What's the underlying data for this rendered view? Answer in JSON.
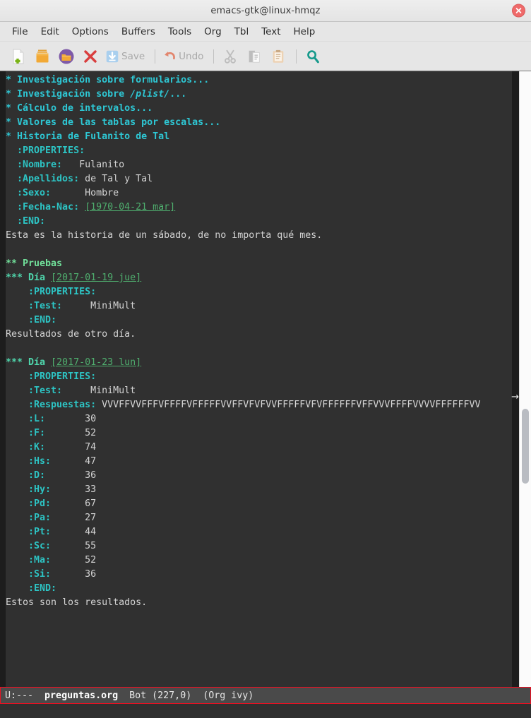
{
  "window": {
    "title": "emacs-gtk@linux-hmqz",
    "close_icon": "close-icon"
  },
  "menubar": {
    "items": [
      {
        "label": "File",
        "name": "menu-file"
      },
      {
        "label": "Edit",
        "name": "menu-edit"
      },
      {
        "label": "Options",
        "name": "menu-options"
      },
      {
        "label": "Buffers",
        "name": "menu-buffers"
      },
      {
        "label": "Tools",
        "name": "menu-tools"
      },
      {
        "label": "Org",
        "name": "menu-org"
      },
      {
        "label": "Tbl",
        "name": "menu-tbl"
      },
      {
        "label": "Text",
        "name": "menu-text"
      },
      {
        "label": "Help",
        "name": "menu-help"
      }
    ]
  },
  "toolbar": {
    "new_file_icon": "new-file-icon",
    "open_file_icon": "open-folder-icon",
    "dired_icon": "open-directory-icon",
    "close_buffer_icon": "close-buffer-icon",
    "save_icon": "save-icon",
    "save_label": "Save",
    "undo_icon": "undo-icon",
    "undo_label": "Undo",
    "cut_icon": "cut-icon",
    "copy_icon": "copy-icon",
    "paste_icon": "paste-icon",
    "search_icon": "search-icon"
  },
  "buffer": {
    "headings": {
      "h1_1": "* Investigación sobre formularios...",
      "h1_2_pre": "* Investigación sobre ",
      "h1_2_ital": "/plist/",
      "h1_2_post": "...",
      "h1_3": "* Cálculo de intervalos...",
      "h1_4": "* Valores de las tablas por escalas...",
      "h1_5": "* Historia de Fulanito de Tal"
    },
    "person_props": {
      "begin": "  :PROPERTIES:",
      "rows": [
        {
          "key": "  :Nombre:   ",
          "value": "Fulanito"
        },
        {
          "key": "  :Apellidos:",
          "value": " de Tal y Tal"
        },
        {
          "key": "  :Sexo:     ",
          "value": " Hombre"
        },
        {
          "key": "  :Fecha-Nac:",
          "value": "[1970-04-21 mar]"
        }
      ],
      "end": "  :END:"
    },
    "intro_text": "Esta es la historia de un sábado, de no importa qué mes.",
    "h2_pruebas": "** Pruebas",
    "day1": {
      "heading_prefix": "*** Día ",
      "heading_date": "[2017-01-19 jue]",
      "prop_begin": "    :PROPERTIES:",
      "test_key": "    :Test:    ",
      "test_value": " MiniMult",
      "prop_end": "    :END:",
      "body_text": "Resultados de otro día."
    },
    "day2": {
      "heading_prefix": "*** Día ",
      "heading_date": "[2017-01-23 lun]",
      "prop_begin": "    :PROPERTIES:",
      "test_key": "    :Test:    ",
      "test_value": " MiniMult",
      "respuestas_key": "    :Respuestas:",
      "respuestas_value": " VVVFFVVFFFVFFFFVFFFFFVVFFVFVFVVFFFFFVFVFFFFFFVFFVVVFFFFVVVVFFFFFFVV",
      "scales": [
        {
          "key": "    :L:      ",
          "value": " 30"
        },
        {
          "key": "    :F:      ",
          "value": " 52"
        },
        {
          "key": "    :K:      ",
          "value": " 74"
        },
        {
          "key": "    :Hs:     ",
          "value": " 47"
        },
        {
          "key": "    :D:      ",
          "value": " 36"
        },
        {
          "key": "    :Hy:     ",
          "value": " 33"
        },
        {
          "key": "    :Pd:     ",
          "value": " 67"
        },
        {
          "key": "    :Pa:     ",
          "value": " 27"
        },
        {
          "key": "    :Pt:     ",
          "value": " 44"
        },
        {
          "key": "    :Sc:     ",
          "value": " 55"
        },
        {
          "key": "    :Ma:     ",
          "value": " 52"
        },
        {
          "key": "    :Si:     ",
          "value": " 36"
        }
      ],
      "prop_end": "    :END:",
      "body_text": "Estos son los resultados."
    },
    "continuation_arrow": "→"
  },
  "modeline": {
    "status": "U:---",
    "buffer_name": "preguntas.org",
    "position": "Bot (227,0)",
    "modes": "(Org ivy)"
  },
  "colors": {
    "background": "#303030",
    "fringe": "#1d1d1d",
    "heading1": "#2ec7d4",
    "heading2": "#71e09a",
    "heading3": "#4fd6ac",
    "property_key": "#2dc4c4",
    "date_link": "#4fae6e",
    "text": "#d4d4d4",
    "modeline_bg": "#4a4a4a",
    "modeline_border": "#e81123",
    "cursor": "#f5f5f5"
  }
}
